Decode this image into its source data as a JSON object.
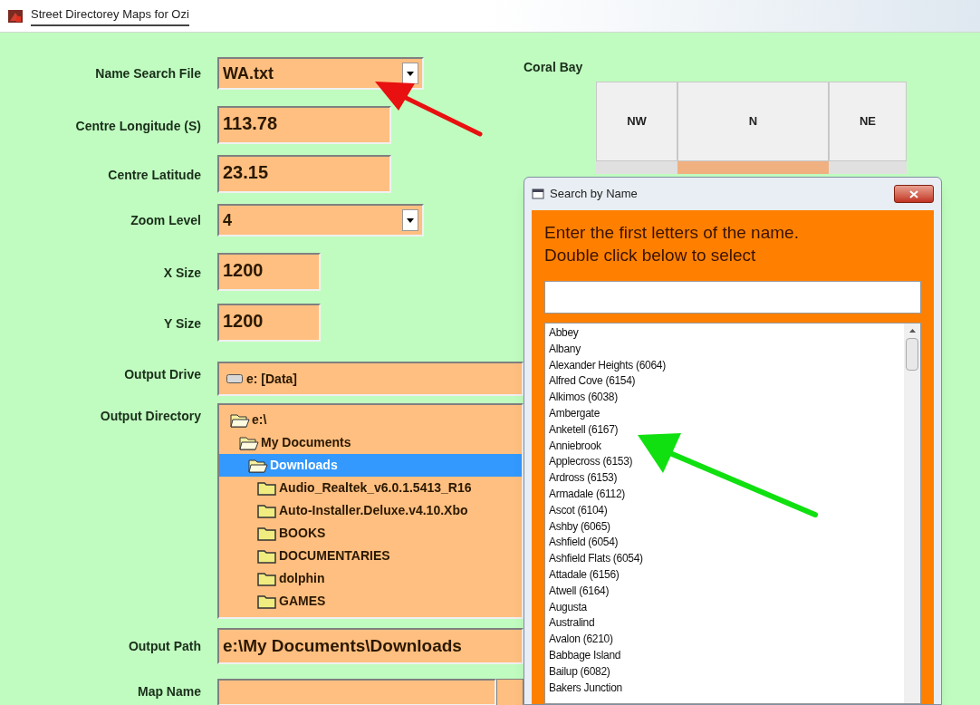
{
  "window": {
    "title": "Street Directorey Maps for Ozi"
  },
  "form": {
    "fields": [
      {
        "kind": "dropdown",
        "label": "Name Search File",
        "value": "WA.txt"
      },
      {
        "kind": "text",
        "label": "Centre Longitude (S)",
        "value": "113.78"
      },
      {
        "kind": "text",
        "label": "Centre Latitude",
        "value": "23.15"
      },
      {
        "kind": "dropdown",
        "label": "Zoom Level",
        "value": "4"
      },
      {
        "kind": "short",
        "label": "X Size",
        "value": "1200"
      },
      {
        "kind": "short",
        "label": "Y Size",
        "value": "1200"
      },
      {
        "kind": "drive",
        "label": "Output Drive",
        "value": "e: [Data]"
      },
      {
        "kind": "tree",
        "label": "Output Directory",
        "items": [
          {
            "label": "e:\\",
            "expanded": true,
            "selected": false,
            "children": [
              {
                "label": "My Documents",
                "expanded": true,
                "selected": false,
                "children": [
                  {
                    "label": "Downloads",
                    "expanded": true,
                    "selected": true,
                    "children": [
                      {
                        "label": "Audio_Realtek_v6.0.1.5413_R16",
                        "expanded": false,
                        "selected": false
                      },
                      {
                        "label": "Auto-Installer.Deluxe.v4.10.Xbo",
                        "expanded": false,
                        "selected": false
                      },
                      {
                        "label": "BOOKS",
                        "expanded": false,
                        "selected": false
                      },
                      {
                        "label": "DOCUMENTARIES",
                        "expanded": false,
                        "selected": false
                      },
                      {
                        "label": "dolphin",
                        "expanded": false,
                        "selected": false
                      },
                      {
                        "label": "GAMES",
                        "expanded": false,
                        "selected": false
                      }
                    ]
                  }
                ]
              }
            ]
          }
        ]
      },
      {
        "kind": "path",
        "label": "Output Path",
        "value": "e:\\My Documents\\Downloads"
      },
      {
        "kind": "browse",
        "label": "Map Name"
      }
    ]
  },
  "map_panel": {
    "title": "Coral Bay",
    "buttons": [
      "NW",
      "N",
      "NE"
    ]
  },
  "dialog": {
    "title": "Search by Name",
    "instructions": [
      "Enter the first letters of the name.",
      "Double click below to select"
    ],
    "items": [
      "Abbey",
      "Albany",
      "Alexander Heights (6064)",
      "Alfred Cove (6154)",
      "Alkimos (6038)",
      "Ambergate",
      "Anketell (6167)",
      "Anniebrook",
      "Applecross (6153)",
      "Ardross (6153)",
      "Armadale (6112)",
      "Ascot (6104)",
      "Ashby (6065)",
      "Ashfield (6054)",
      "Ashfield Flats (6054)",
      "Attadale (6156)",
      "Atwell (6164)",
      "Augusta",
      "Australind",
      "Avalon (6210)",
      "Babbage Island",
      "Bailup (6082)",
      "Bakers Junction"
    ]
  }
}
